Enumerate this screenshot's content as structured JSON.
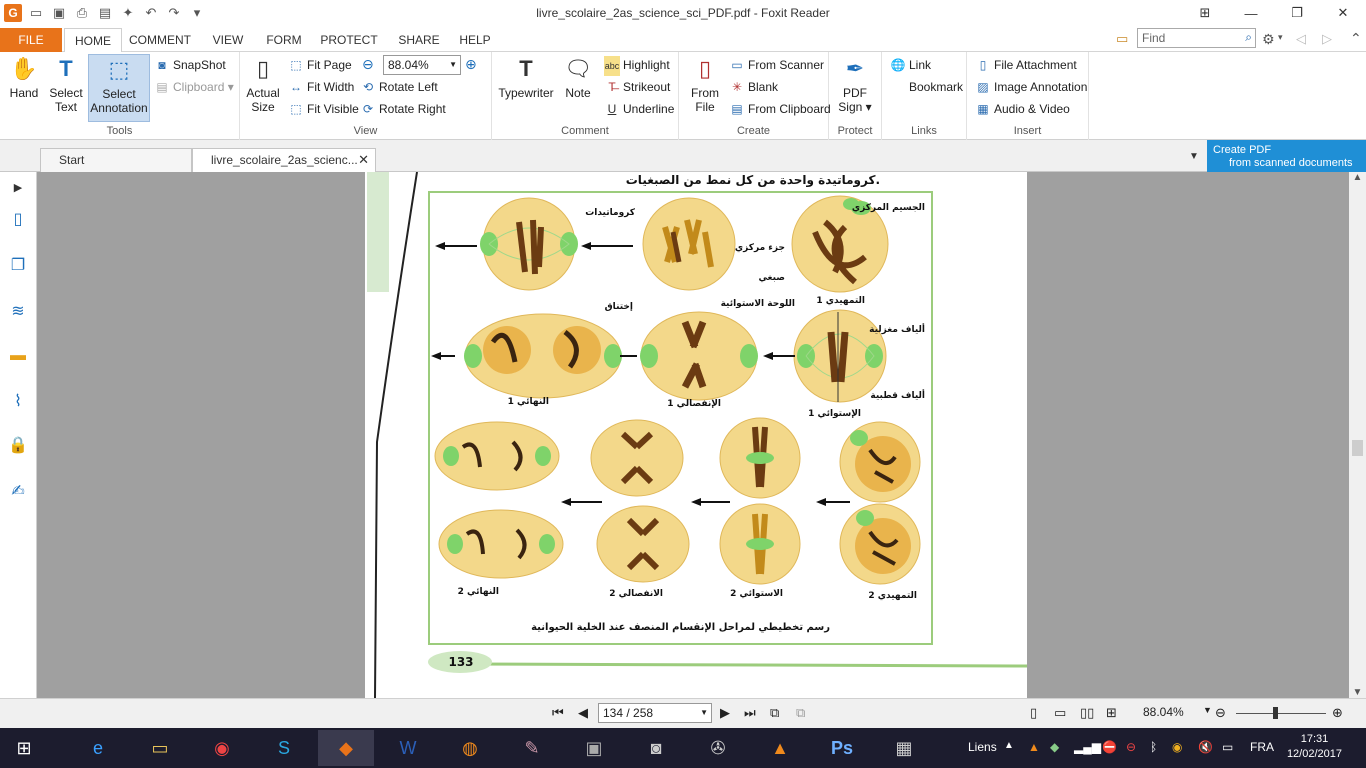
{
  "window": {
    "title": "livre_scolaire_2as_science_sci_PDF.pdf - Foxit Reader"
  },
  "ribbon_tabs": [
    "FILE",
    "HOME",
    "COMMENT",
    "VIEW",
    "FORM",
    "PROTECT",
    "SHARE",
    "HELP"
  ],
  "find": {
    "placeholder": "Find"
  },
  "tools": {
    "hand": "Hand",
    "select_text": [
      "Select",
      "Text"
    ],
    "select_annotation": [
      "Select",
      "Annotation"
    ],
    "snapshot": "SnapShot",
    "clipboard": "Clipboard",
    "group": "Tools"
  },
  "view": {
    "actual_size": [
      "Actual",
      "Size"
    ],
    "fit_page": "Fit Page",
    "fit_width": "Fit Width",
    "fit_visible": "Fit Visible",
    "zoom": "88.04%",
    "rotate_left": "Rotate Left",
    "rotate_right": "Rotate Right",
    "group": "View"
  },
  "comment": {
    "typewriter": "Typewriter",
    "note": "Note",
    "highlight": "Highlight",
    "strikeout": "Strikeout",
    "underline": "Underline",
    "group": "Comment"
  },
  "create": {
    "from_file": [
      "From",
      "File"
    ],
    "from_scanner": "From Scanner",
    "blank": "Blank",
    "from_clipboard": "From Clipboard",
    "group": "Create"
  },
  "protect": {
    "pdf_sign": [
      "PDF",
      "Sign"
    ],
    "group": "Protect"
  },
  "links": {
    "link": "Link",
    "bookmark": "Bookmark",
    "group": "Links"
  },
  "insert": {
    "file_attachment": "File Attachment",
    "image_annotation": "Image Annotation",
    "audio_video": "Audio & Video",
    "group": "Insert"
  },
  "doc_tabs": [
    {
      "label": "Start"
    },
    {
      "label": "livre_scolaire_2as_scienc..."
    }
  ],
  "banner": {
    "line1": "Create PDF",
    "line2": "from scanned documents"
  },
  "page_content": {
    "heading": "كروماتيدة واحدة من كل نمط من الصبغيات.",
    "caption": "رسم تخطيطي لمراحل الإنقسام المنصف عند الخلية الحيوانية",
    "page_number": "133",
    "labels": {
      "centrosome": "الجسيم المركزي",
      "chromatids": "كروماتيدات",
      "centromere": "جزء مركزي",
      "chromosome": "صبغي",
      "prophase1": "التمهيدي 1",
      "equatorial_plate": "اللوحة الاستوائية",
      "constriction": "إختناق",
      "spindle_fibers": "ألياف مغزلية",
      "polar_fibers": "ألياف قطبية",
      "metaphase1": "الإستوائي 1",
      "anaphase1": "الإنفصالي 1",
      "telophase1": "النهائي 1",
      "prophase2": "التمهيدي 2",
      "metaphase2": "الاستوائي 2",
      "anaphase2": "الانفصالي 2",
      "telophase2": "النهائي 2"
    }
  },
  "status": {
    "page": "134 / 258",
    "zoom": "88.04%"
  },
  "taskbar": {
    "liens": "Liens",
    "lang": "FRA",
    "time": "17:31",
    "date": "12/02/2017"
  },
  "colors": {
    "accent": "#e8731a",
    "banner": "#1f8fd6",
    "taskbar": "#1c1c2e",
    "cell": "#f3d88a",
    "spindle": "#7fd36a",
    "frame": "#9ccc7c"
  }
}
